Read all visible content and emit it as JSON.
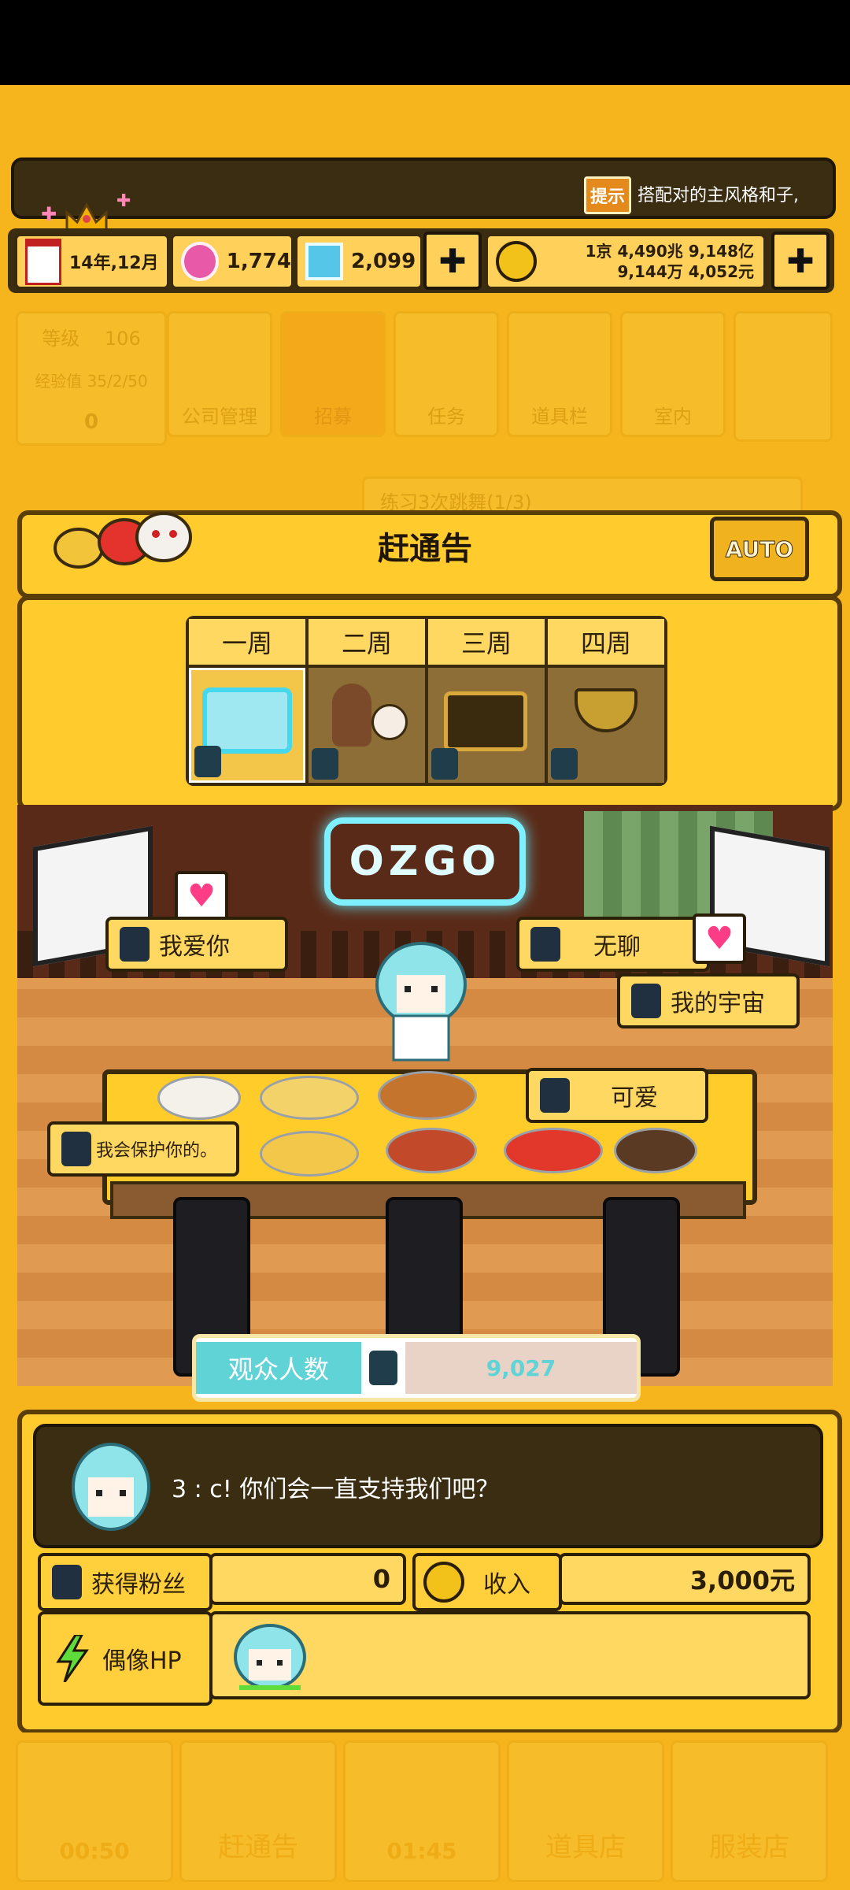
{
  "hud": {
    "tip_icon_label": "提示",
    "tip_text": "搭配对的主风格和子,",
    "date": "14年,12月",
    "gems_pink": "1,774",
    "gems_blue": "2,099",
    "money_line1": "1京 4,490兆 9,148亿",
    "money_line2": "9,144万 4,052元",
    "plus_label": "✚"
  },
  "bg_menu": {
    "level_label": "等级",
    "level_value": "106",
    "exp_label": "经验值 35/2/50",
    "exp_value": "0",
    "items": [
      "公司管理",
      "招募",
      "任务",
      "道具栏",
      "室内"
    ]
  },
  "bg_banner": "练习3次跳舞(1/3)",
  "panel": {
    "title": "赶通告",
    "auto_label": "AUTO",
    "weeks": [
      "一周",
      "二周",
      "三周",
      "四周"
    ]
  },
  "stage": {
    "neon_sign": "OZGO",
    "chats": [
      "我爱你",
      "无聊",
      "我的宇宙",
      "可爱",
      "我会保护你的。"
    ],
    "audience_label": "观众人数",
    "audience_value": "9,027"
  },
  "dialog": {
    "speaker_text": "3 : c! 你们会一直支持我们吧？"
  },
  "stats": {
    "fans_label": "获得粉丝",
    "fans_value": "0",
    "income_label": "收入",
    "income_value": "3,000元",
    "hp_label": "偶像HP"
  },
  "bottom_menu": {
    "time1": "00:50",
    "item1": "赶通告",
    "time2": "01:45",
    "item2": "道具店",
    "item3": "服装店"
  },
  "colors": {
    "background": "#f6b51c",
    "panel_border": "#5a3e0a",
    "dark_hud": "#3b2d12",
    "teal": "#5fd3d6"
  }
}
